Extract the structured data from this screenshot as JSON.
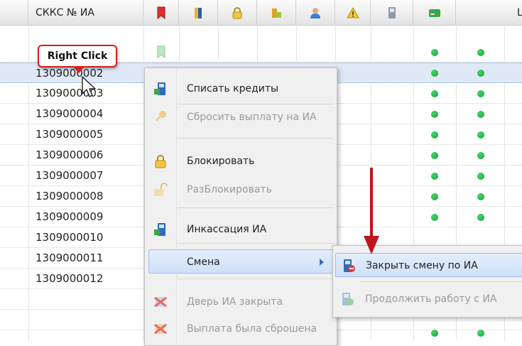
{
  "grid": {
    "id_column_header": "СККС № ИА",
    "last_column_header_partial": "Ц",
    "column_icons": [
      "bookmark-icon",
      "door-icon",
      "lock-icon",
      "coins-icon",
      "user-icon",
      "warning-icon",
      "terminal-icon",
      "card-icon"
    ],
    "rows": [
      {
        "id": ""
      },
      {
        "id": "1309000002"
      },
      {
        "id": "1309000003"
      },
      {
        "id": "1309000004"
      },
      {
        "id": "1309000005"
      },
      {
        "id": "1309000006"
      },
      {
        "id": "1309000007"
      },
      {
        "id": "1309000008"
      },
      {
        "id": "1309000009"
      },
      {
        "id": "1309000010"
      },
      {
        "id": "1309000011"
      },
      {
        "id": "1309000012"
      }
    ],
    "selected_row_index": 1,
    "status_color": "#1fb040"
  },
  "tooltip": {
    "label": "Right Click"
  },
  "context_menu": {
    "items": [
      {
        "label": "Списать кредиты",
        "icon": "terminal-credit-icon",
        "disabled": false
      },
      {
        "label": "Сбросить выплату на ИА",
        "icon": "key-icon",
        "disabled": true
      },
      {
        "label": "Блокировать",
        "icon": "lock-icon",
        "disabled": false
      },
      {
        "label": "РазБлокировать",
        "icon": "unlock-icon",
        "disabled": true
      },
      {
        "label": "Инкассация ИА",
        "icon": "terminal-cash-icon",
        "disabled": false
      },
      {
        "label": "Смена",
        "icon": "",
        "disabled": false,
        "has_submenu": true
      },
      {
        "label": "Дверь ИА закрыта",
        "icon": "door-closed-icon",
        "disabled": true
      },
      {
        "label": "Выплата была сброшена",
        "icon": "payout-reset-icon",
        "disabled": true
      }
    ]
  },
  "submenu": {
    "items": [
      {
        "label": "Закрыть смену по ИА",
        "icon": "close-shift-icon",
        "disabled": false
      },
      {
        "label": "Продолжить работу с ИА",
        "icon": "continue-work-icon",
        "disabled": true
      }
    ]
  },
  "colors": {
    "accent_arrow": "#c0141e",
    "menu_highlight": "#cfe0f7"
  }
}
